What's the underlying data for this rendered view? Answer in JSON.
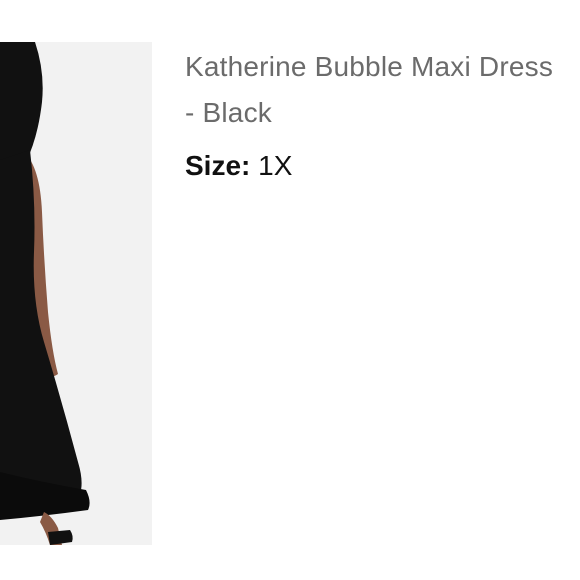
{
  "product": {
    "title": "Katherine Bubble Maxi Dress - Black",
    "size_label": "Size:",
    "size_value": "1X",
    "image": {
      "subject": "model-wearing-black-maxi-dress"
    }
  }
}
